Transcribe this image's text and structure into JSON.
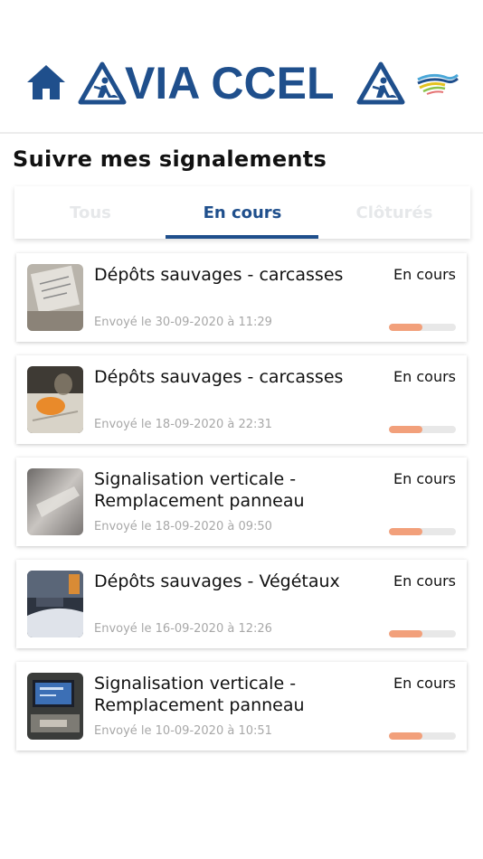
{
  "header": {
    "logo_text": "VIA CCEL",
    "colors": {
      "brand": "#1f4f8c",
      "accent": "#f2a07b"
    }
  },
  "page_title": "Suivre mes signalements",
  "tabs": [
    {
      "label": "Tous",
      "active": false
    },
    {
      "label": "En cours",
      "active": true
    },
    {
      "label": "Clôturés",
      "active": false
    }
  ],
  "reports": [
    {
      "title": "Dépôts sauvages - carcasses",
      "date": "Envoyé le 30-09-2020 à 11:29",
      "status": "En cours",
      "progress": 0.5
    },
    {
      "title": "Dépôts sauvages - carcasses",
      "date": "Envoyé le 18-09-2020 à 22:31",
      "status": "En cours",
      "progress": 0.5
    },
    {
      "title": "Signalisation verticale - Remplacement panneau",
      "date": "Envoyé le 18-09-2020 à 09:50",
      "status": "En cours",
      "progress": 0.5
    },
    {
      "title": "Dépôts sauvages - Végétaux",
      "date": "Envoyé le 16-09-2020 à 12:26",
      "status": "En cours",
      "progress": 0.5
    },
    {
      "title": "Signalisation verticale - Remplacement panneau",
      "date": "Envoyé le 10-09-2020 à 10:51",
      "status": "En cours",
      "progress": 0.5
    }
  ]
}
